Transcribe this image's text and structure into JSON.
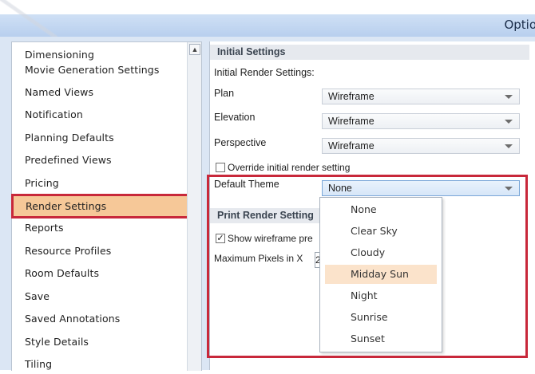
{
  "window": {
    "title_visible": "Optio"
  },
  "sidebar": {
    "items": [
      {
        "label": "Dimensioning"
      },
      {
        "label": "Movie Generation Settings"
      },
      {
        "label": "Named Views"
      },
      {
        "label": "Notification"
      },
      {
        "label": "Planning Defaults"
      },
      {
        "label": "Predefined Views"
      },
      {
        "label": "Pricing"
      },
      {
        "label": "Render Settings",
        "selected": true
      },
      {
        "label": "Reports"
      },
      {
        "label": "Resource Profiles"
      },
      {
        "label": "Room Defaults"
      },
      {
        "label": "Save"
      },
      {
        "label": "Saved Annotations"
      },
      {
        "label": "Style Details"
      },
      {
        "label": "Tiling"
      }
    ]
  },
  "main": {
    "initial_settings": {
      "header": "Initial Settings",
      "subheading": "Initial Render Settings:",
      "plan_label": "Plan",
      "plan_value": "Wireframe",
      "elevation_label": "Elevation",
      "elevation_value": "Wireframe",
      "perspective_label": "Perspective",
      "perspective_value": "Wireframe",
      "override_label": "Override initial render setting",
      "override_checked": false,
      "theme_label": "Default Theme",
      "theme_value": "None"
    },
    "print_settings": {
      "header_visible": "Print Render Setting",
      "show_wireframe_visible": "Show wireframe pre",
      "show_wireframe_checked": true,
      "max_pixels_label": "Maximum Pixels in X",
      "max_pixels_value_visible": "2"
    },
    "theme_dropdown": {
      "options": [
        "None",
        "Clear Sky",
        "Cloudy",
        "Midday Sun",
        "Night",
        "Sunrise",
        "Sunset"
      ],
      "highlighted": "Midday Sun"
    }
  },
  "colors": {
    "selection": "#f6c898",
    "annotation_border": "#c8283a",
    "dropdown_highlight": "#fbe3cb"
  }
}
